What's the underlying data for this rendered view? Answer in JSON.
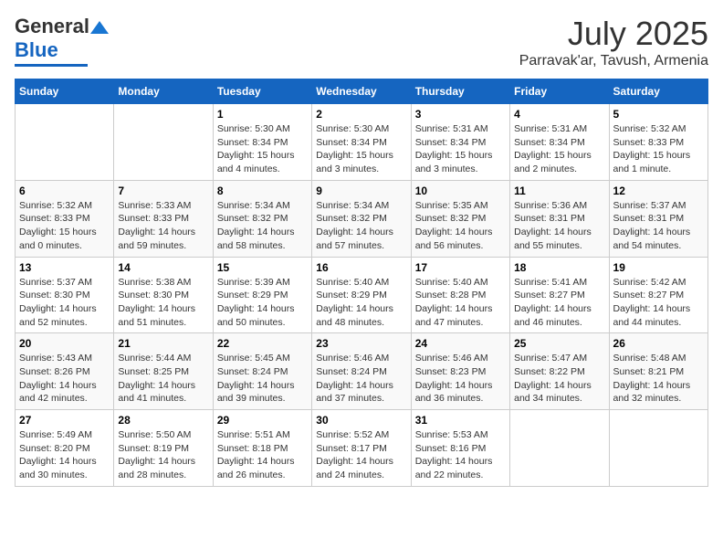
{
  "logo": {
    "general": "General",
    "blue": "Blue"
  },
  "title": {
    "month": "July 2025",
    "location": "Parravak'ar, Tavush, Armenia"
  },
  "headers": [
    "Sunday",
    "Monday",
    "Tuesday",
    "Wednesday",
    "Thursday",
    "Friday",
    "Saturday"
  ],
  "weeks": [
    [
      {
        "day": "",
        "info": ""
      },
      {
        "day": "",
        "info": ""
      },
      {
        "day": "1",
        "info": "Sunrise: 5:30 AM\nSunset: 8:34 PM\nDaylight: 15 hours\nand 4 minutes."
      },
      {
        "day": "2",
        "info": "Sunrise: 5:30 AM\nSunset: 8:34 PM\nDaylight: 15 hours\nand 3 minutes."
      },
      {
        "day": "3",
        "info": "Sunrise: 5:31 AM\nSunset: 8:34 PM\nDaylight: 15 hours\nand 3 minutes."
      },
      {
        "day": "4",
        "info": "Sunrise: 5:31 AM\nSunset: 8:34 PM\nDaylight: 15 hours\nand 2 minutes."
      },
      {
        "day": "5",
        "info": "Sunrise: 5:32 AM\nSunset: 8:33 PM\nDaylight: 15 hours\nand 1 minute."
      }
    ],
    [
      {
        "day": "6",
        "info": "Sunrise: 5:32 AM\nSunset: 8:33 PM\nDaylight: 15 hours\nand 0 minutes."
      },
      {
        "day": "7",
        "info": "Sunrise: 5:33 AM\nSunset: 8:33 PM\nDaylight: 14 hours\nand 59 minutes."
      },
      {
        "day": "8",
        "info": "Sunrise: 5:34 AM\nSunset: 8:32 PM\nDaylight: 14 hours\nand 58 minutes."
      },
      {
        "day": "9",
        "info": "Sunrise: 5:34 AM\nSunset: 8:32 PM\nDaylight: 14 hours\nand 57 minutes."
      },
      {
        "day": "10",
        "info": "Sunrise: 5:35 AM\nSunset: 8:32 PM\nDaylight: 14 hours\nand 56 minutes."
      },
      {
        "day": "11",
        "info": "Sunrise: 5:36 AM\nSunset: 8:31 PM\nDaylight: 14 hours\nand 55 minutes."
      },
      {
        "day": "12",
        "info": "Sunrise: 5:37 AM\nSunset: 8:31 PM\nDaylight: 14 hours\nand 54 minutes."
      }
    ],
    [
      {
        "day": "13",
        "info": "Sunrise: 5:37 AM\nSunset: 8:30 PM\nDaylight: 14 hours\nand 52 minutes."
      },
      {
        "day": "14",
        "info": "Sunrise: 5:38 AM\nSunset: 8:30 PM\nDaylight: 14 hours\nand 51 minutes."
      },
      {
        "day": "15",
        "info": "Sunrise: 5:39 AM\nSunset: 8:29 PM\nDaylight: 14 hours\nand 50 minutes."
      },
      {
        "day": "16",
        "info": "Sunrise: 5:40 AM\nSunset: 8:29 PM\nDaylight: 14 hours\nand 48 minutes."
      },
      {
        "day": "17",
        "info": "Sunrise: 5:40 AM\nSunset: 8:28 PM\nDaylight: 14 hours\nand 47 minutes."
      },
      {
        "day": "18",
        "info": "Sunrise: 5:41 AM\nSunset: 8:27 PM\nDaylight: 14 hours\nand 46 minutes."
      },
      {
        "day": "19",
        "info": "Sunrise: 5:42 AM\nSunset: 8:27 PM\nDaylight: 14 hours\nand 44 minutes."
      }
    ],
    [
      {
        "day": "20",
        "info": "Sunrise: 5:43 AM\nSunset: 8:26 PM\nDaylight: 14 hours\nand 42 minutes."
      },
      {
        "day": "21",
        "info": "Sunrise: 5:44 AM\nSunset: 8:25 PM\nDaylight: 14 hours\nand 41 minutes."
      },
      {
        "day": "22",
        "info": "Sunrise: 5:45 AM\nSunset: 8:24 PM\nDaylight: 14 hours\nand 39 minutes."
      },
      {
        "day": "23",
        "info": "Sunrise: 5:46 AM\nSunset: 8:24 PM\nDaylight: 14 hours\nand 37 minutes."
      },
      {
        "day": "24",
        "info": "Sunrise: 5:46 AM\nSunset: 8:23 PM\nDaylight: 14 hours\nand 36 minutes."
      },
      {
        "day": "25",
        "info": "Sunrise: 5:47 AM\nSunset: 8:22 PM\nDaylight: 14 hours\nand 34 minutes."
      },
      {
        "day": "26",
        "info": "Sunrise: 5:48 AM\nSunset: 8:21 PM\nDaylight: 14 hours\nand 32 minutes."
      }
    ],
    [
      {
        "day": "27",
        "info": "Sunrise: 5:49 AM\nSunset: 8:20 PM\nDaylight: 14 hours\nand 30 minutes."
      },
      {
        "day": "28",
        "info": "Sunrise: 5:50 AM\nSunset: 8:19 PM\nDaylight: 14 hours\nand 28 minutes."
      },
      {
        "day": "29",
        "info": "Sunrise: 5:51 AM\nSunset: 8:18 PM\nDaylight: 14 hours\nand 26 minutes."
      },
      {
        "day": "30",
        "info": "Sunrise: 5:52 AM\nSunset: 8:17 PM\nDaylight: 14 hours\nand 24 minutes."
      },
      {
        "day": "31",
        "info": "Sunrise: 5:53 AM\nSunset: 8:16 PM\nDaylight: 14 hours\nand 22 minutes."
      },
      {
        "day": "",
        "info": ""
      },
      {
        "day": "",
        "info": ""
      }
    ]
  ]
}
